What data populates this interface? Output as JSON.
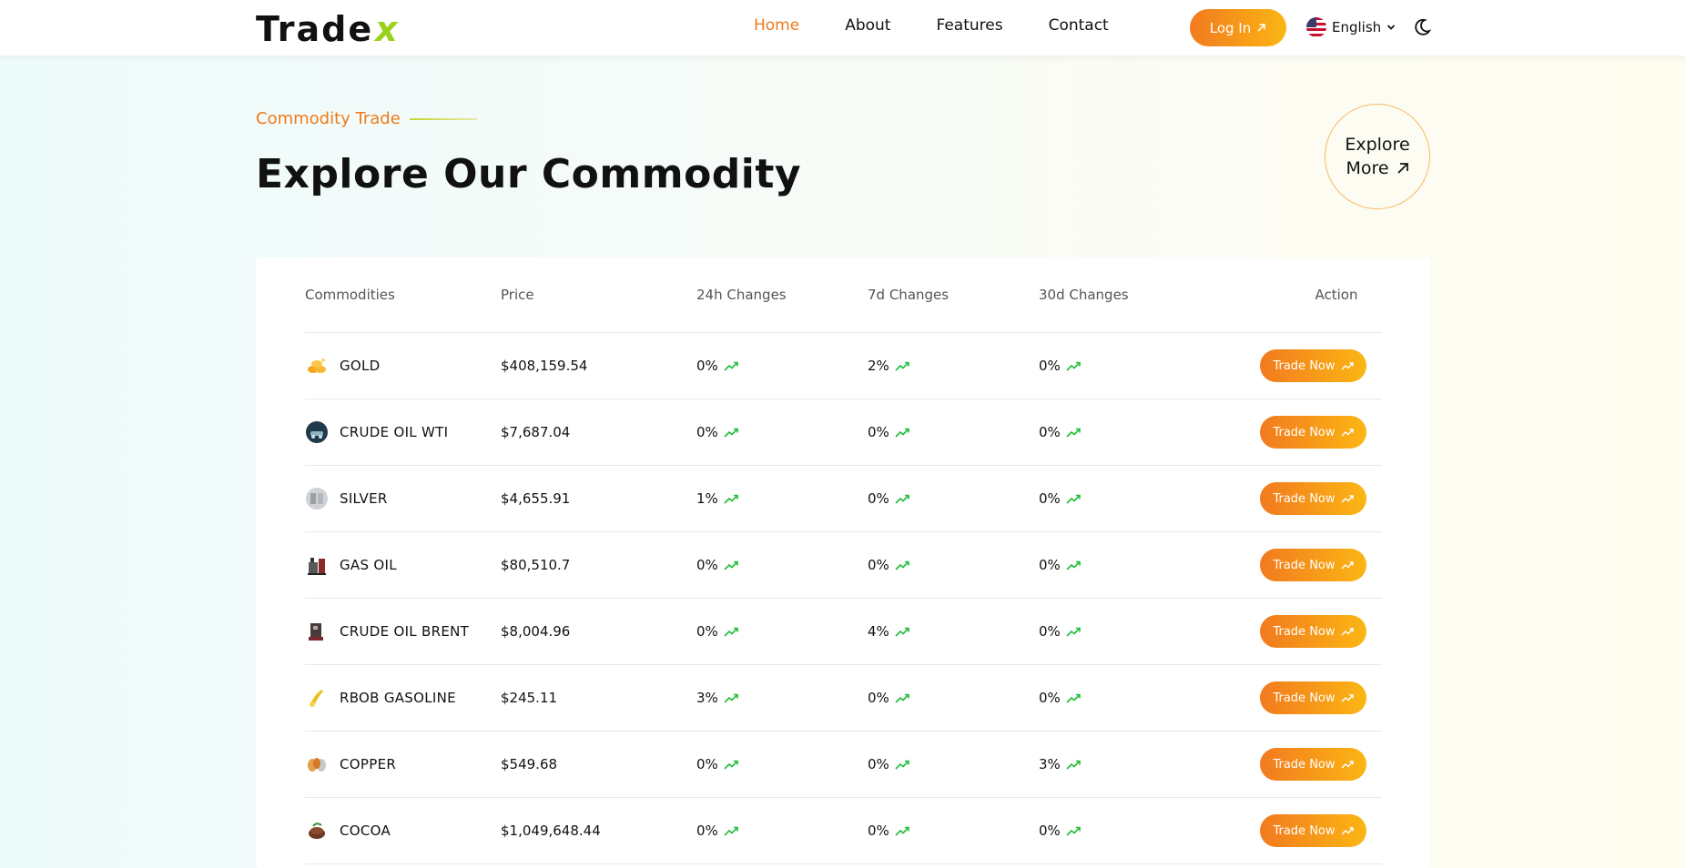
{
  "header": {
    "logo_main": "Trade",
    "logo_accent": "x",
    "nav": [
      {
        "label": "Home",
        "active": true
      },
      {
        "label": "About",
        "active": false
      },
      {
        "label": "Features",
        "active": false
      },
      {
        "label": "Contact",
        "active": false
      }
    ],
    "login_label": "Log In",
    "language": "English"
  },
  "section": {
    "eyebrow": "Commodity Trade",
    "title": "Explore Our Commodity",
    "explore_line1": "Explore",
    "explore_line2": "More"
  },
  "table": {
    "headers": [
      "Commodities",
      "Price",
      "24h Changes",
      "7d Changes",
      "30d Changes",
      "Action"
    ],
    "action_label": "Trade Now",
    "rows": [
      {
        "name": "GOLD",
        "icon": "gold-icon",
        "price": "$408,159.54",
        "d24": "0%",
        "d7": "2%",
        "d30": "0%"
      },
      {
        "name": "CRUDE OIL WTI",
        "icon": "crude-oil-wti-icon",
        "price": "$7,687.04",
        "d24": "0%",
        "d7": "0%",
        "d30": "0%"
      },
      {
        "name": "SILVER",
        "icon": "silver-icon",
        "price": "$4,655.91",
        "d24": "1%",
        "d7": "0%",
        "d30": "0%"
      },
      {
        "name": "GAS OIL",
        "icon": "gas-oil-icon",
        "price": "$80,510.7",
        "d24": "0%",
        "d7": "0%",
        "d30": "0%"
      },
      {
        "name": "CRUDE OIL BRENT",
        "icon": "crude-oil-brent-icon",
        "price": "$8,004.96",
        "d24": "0%",
        "d7": "4%",
        "d30": "0%"
      },
      {
        "name": "RBOB GASOLINE",
        "icon": "rbob-gasoline-icon",
        "price": "$245.11",
        "d24": "3%",
        "d7": "0%",
        "d30": "0%"
      },
      {
        "name": "COPPER",
        "icon": "copper-icon",
        "price": "$549.68",
        "d24": "0%",
        "d7": "0%",
        "d30": "3%"
      },
      {
        "name": "COCOA",
        "icon": "cocoa-icon",
        "price": "$1,049,648.44",
        "d24": "0%",
        "d7": "0%",
        "d30": "0%"
      }
    ]
  },
  "colors": {
    "accent": "#f07a1a",
    "button_gradient_start": "#f27a1f",
    "button_gradient_end": "#fbb614",
    "trend_up": "#1fbf3a"
  }
}
